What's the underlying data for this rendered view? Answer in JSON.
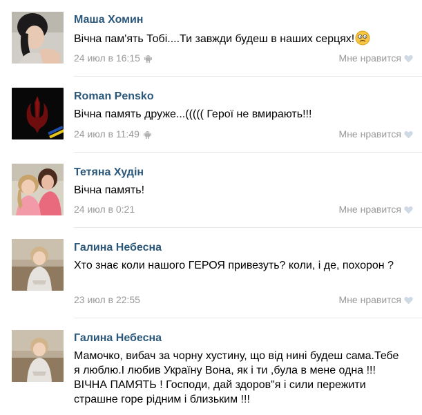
{
  "comments": [
    {
      "author": "Маша Хомин",
      "text": "Вічна пам'ять Тобі....Ти завжди будеш в наших серцях!",
      "date": "24 июл в 16:15",
      "like_label": "Мне нравится"
    },
    {
      "author": "Roman Pensko",
      "text": "Вічна память друже...((((( Герої не вмирають!!!",
      "date": "24 июл в 11:49",
      "like_label": "Мне нравится"
    },
    {
      "author": "Тетяна Худін",
      "text": "Вічна память!",
      "date": "24 июл в 0:21",
      "like_label": "Мне нравится"
    },
    {
      "author": "Галина Небесна",
      "text": "Хто знає коли нашого ГЕРОЯ привезуть? коли, і де, похорон ?",
      "date": "23 июл в 22:55",
      "like_label": "Мне нравится"
    },
    {
      "author": "Галина Небесна",
      "text": "Мамочко, вибач за чорну хустину, що від нині будеш сама.Тебе я люблю.І любив Україну Вона, як і ти ,була в мене одна !!! ВІЧНА ПАМЯТЬ ! Господи, дай здоров\"я і сили пережити страшне горе рідним і близьким !!!"
    }
  ],
  "colors": {
    "author": "#2b587a",
    "meta": "#999999",
    "separator": "#e4e8ec",
    "like_heart": "#d0dae5"
  }
}
